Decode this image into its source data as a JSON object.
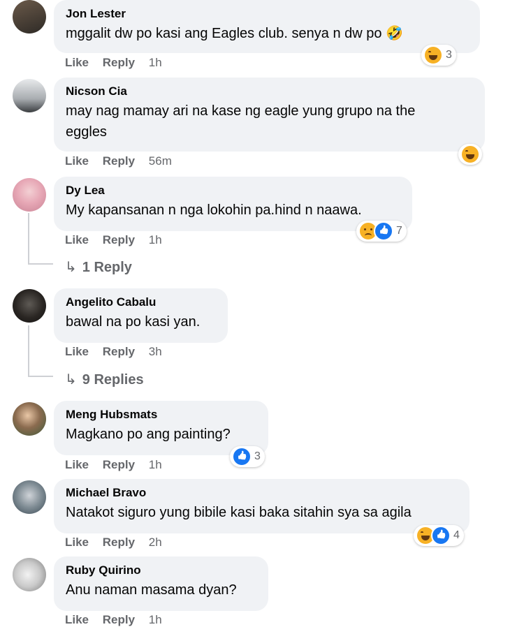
{
  "comments": [
    {
      "name": "Jon Lester",
      "text": "mggalit dw po kasi ang Eagles club. senya n dw po 🤣",
      "like": "Like",
      "reply": "Reply",
      "time": "1h",
      "reaction_count": "3"
    },
    {
      "name": "Nicson Cia",
      "text": "may nag mamay ari na kase ng eagle yung grupo na the\neggles",
      "like": "Like",
      "reply": "Reply",
      "time": "56m",
      "reaction_count": ""
    },
    {
      "name": "Dy Lea",
      "text": "My kapansanan n nga lokohin pa.hind n naawa.",
      "like": "Like",
      "reply": "Reply",
      "time": "1h",
      "reaction_count": "7"
    },
    {
      "name": "Angelito Cabalu",
      "text": "bawal na po kasi yan.",
      "like": "Like",
      "reply": "Reply",
      "time": "3h",
      "reaction_count": ""
    },
    {
      "name": "Meng Hubsmats",
      "text": "Magkano po ang painting?",
      "like": "Like",
      "reply": "Reply",
      "time": "1h",
      "reaction_count": "3"
    },
    {
      "name": "Michael Bravo",
      "text": "Natakot siguro yung bibile kasi baka sitahin sya sa agila",
      "like": "Like",
      "reply": "Reply",
      "time": "2h",
      "reaction_count": "4"
    },
    {
      "name": "Ruby Quirino",
      "text": "Anu naman masama dyan?",
      "like": "Like",
      "reply": "Reply",
      "time": "1h",
      "reaction_count": ""
    }
  ],
  "reply_links": {
    "dy_lea": "1 Reply",
    "angelito": "9 Replies"
  },
  "icons": {
    "reply_arrow": "reply-arrow-icon",
    "haha": "haha-reaction-icon",
    "like": "like-reaction-icon",
    "sad": "sad-reaction-icon"
  },
  "colors": {
    "bubble": "#f0f2f5",
    "meta": "#65676b",
    "like_blue": "#1877f2",
    "haha_yellow": "#f7b125"
  }
}
